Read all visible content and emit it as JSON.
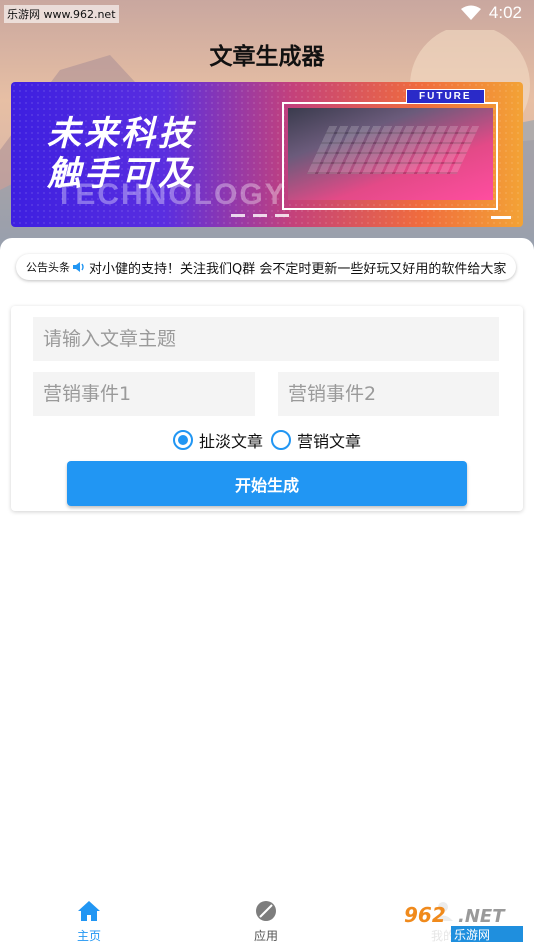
{
  "status_bar": {
    "watermark": "乐游网 www.962.net",
    "time": "4:02"
  },
  "app": {
    "title": "文章生成器"
  },
  "banner": {
    "headline_line1": "未来科技",
    "headline_line2": "触手可及",
    "background_word": "TECHNOLOGY",
    "tag": "FUTURE"
  },
  "notice": {
    "label": "公告头条",
    "text": "对小健的支持！关注我们Q群 会不定时更新一些好玩又好用的软件给大家"
  },
  "form": {
    "topic_placeholder": "请输入文章主题",
    "event1_placeholder": "营销事件1",
    "event2_placeholder": "营销事件2",
    "radio_options": [
      {
        "label": "扯淡文章",
        "selected": true
      },
      {
        "label": "营销文章",
        "selected": false
      }
    ],
    "submit_label": "开始生成"
  },
  "bottom_nav": {
    "items": [
      {
        "label": "主页",
        "icon": "home-icon",
        "active": true
      },
      {
        "label": "应用",
        "icon": "apps-icon",
        "active": false
      },
      {
        "label": "我的",
        "icon": "profile-icon",
        "active": false
      }
    ]
  },
  "colors": {
    "accent": "#2196f3",
    "nav_active": "#2196f3",
    "nav_inactive": "#555555"
  }
}
